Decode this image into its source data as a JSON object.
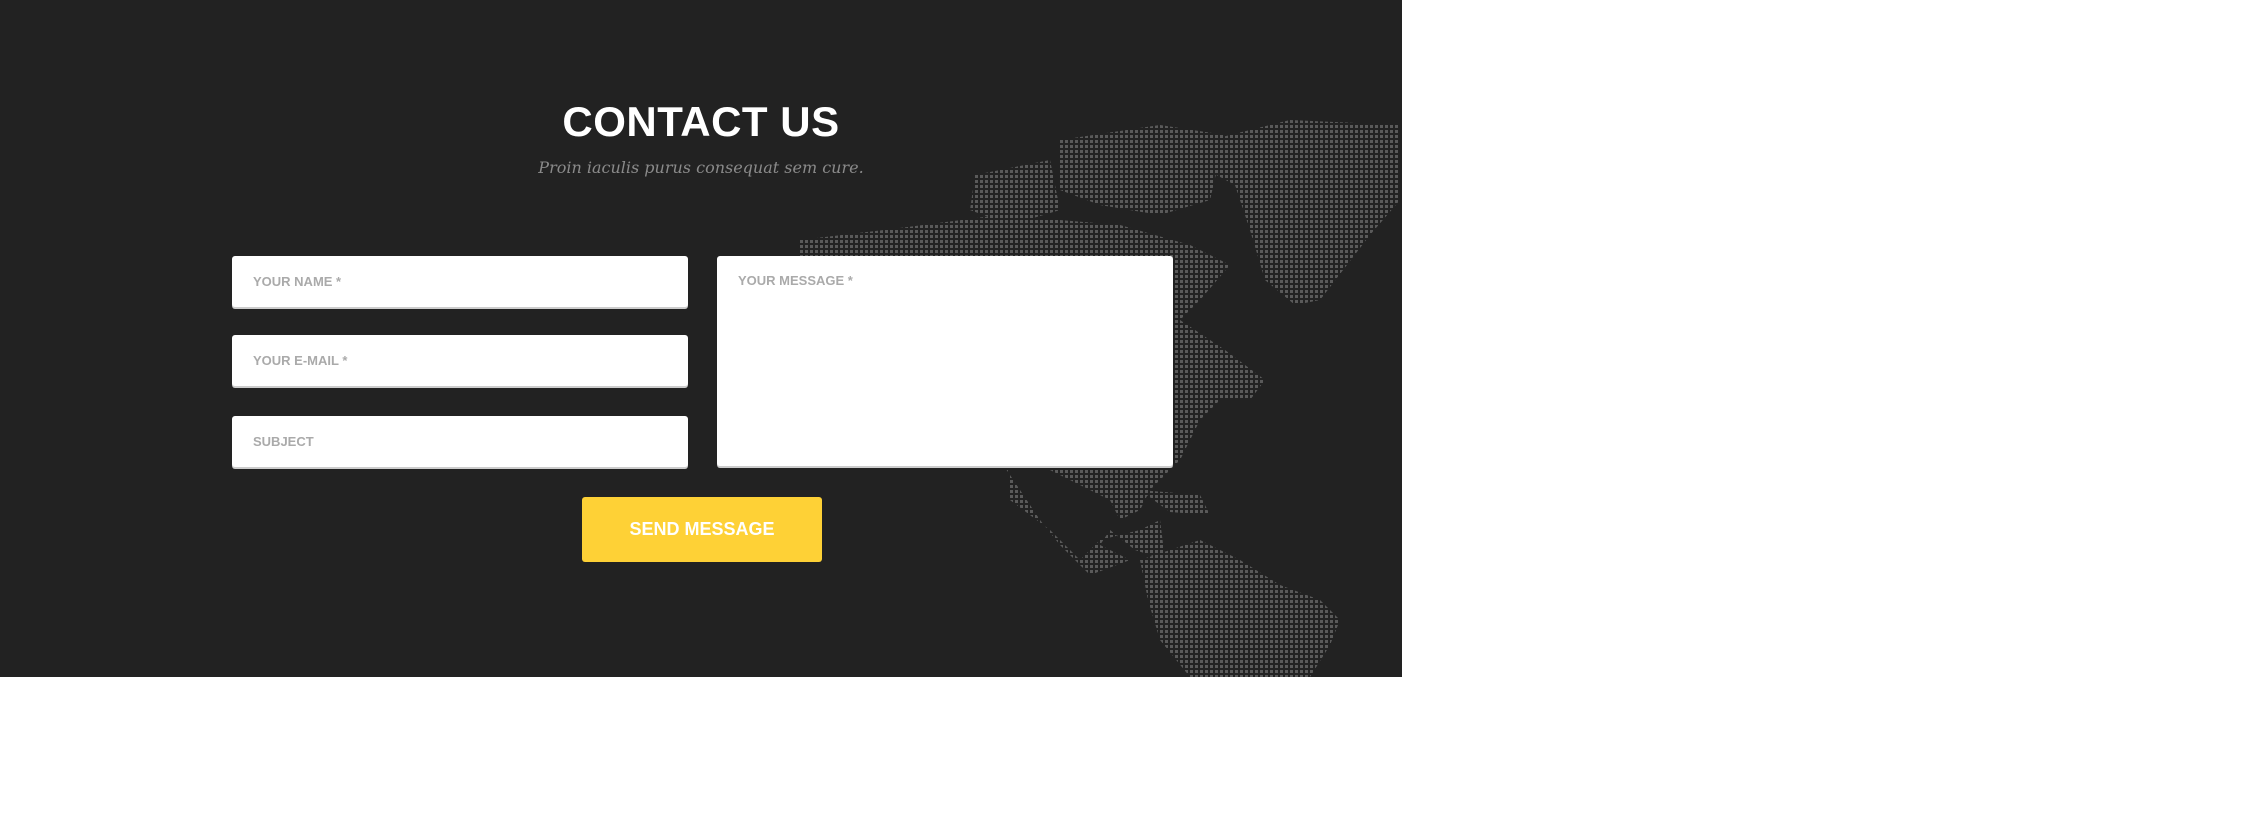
{
  "contact": {
    "title": "CONTACT US",
    "subtitle": "Proin iaculis purus consequat sem cure.",
    "fields": {
      "name_placeholder": "YOUR NAME *",
      "email_placeholder": "YOUR E-MAIL *",
      "subject_placeholder": "SUBJECT",
      "message_placeholder": "YOUR MESSAGE *"
    },
    "submit_label": "SEND MESSAGE",
    "background_graphic": "dotted-world-map",
    "colors": {
      "background": "#222222",
      "accent": "#fed136",
      "map_dots": "#5a5a5a"
    }
  }
}
